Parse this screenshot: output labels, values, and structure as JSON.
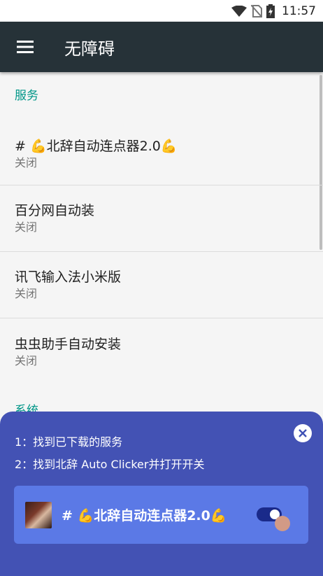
{
  "status_bar": {
    "time": "11:57",
    "icons": [
      "wifi-icon",
      "no-sim-icon",
      "battery-charging-icon"
    ]
  },
  "toolbar": {
    "title": "无障碍",
    "menu_icon": "hamburger-menu-icon"
  },
  "sections": {
    "services_header": "服务",
    "system_header": "系统"
  },
  "services": [
    {
      "title": "# 💪北辞自动连点器2.0💪",
      "summary": "关闭"
    },
    {
      "title": "百分网自动装",
      "summary": "关闭"
    },
    {
      "title": "讯飞输入法小米版",
      "summary": "关闭"
    },
    {
      "title": "虫虫助手自动安装",
      "summary": "关闭"
    }
  ],
  "guide": {
    "step1": "1：找到已下载的服务",
    "step2": "2：找到北辞 Auto Clicker并打开开关",
    "card_title": "# 💪北辞自动连点器2.0💪",
    "close_icon": "close-icon",
    "toggle_state": "on"
  }
}
